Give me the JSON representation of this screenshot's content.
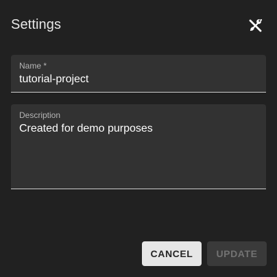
{
  "dialog": {
    "title": "Settings",
    "close_icon": "close-tools-icon"
  },
  "fields": {
    "name": {
      "label": "Name *",
      "value": "tutorial-project"
    },
    "description": {
      "label": "Description",
      "value": "Created for demo purposes"
    }
  },
  "actions": {
    "cancel_label": "CANCEL",
    "update_label": "UPDATE",
    "update_disabled": true
  },
  "colors": {
    "background": "#212121",
    "field_background": "#323232",
    "cancel_background": "#e6e6e6",
    "update_background_disabled": "#3a3a3a"
  }
}
